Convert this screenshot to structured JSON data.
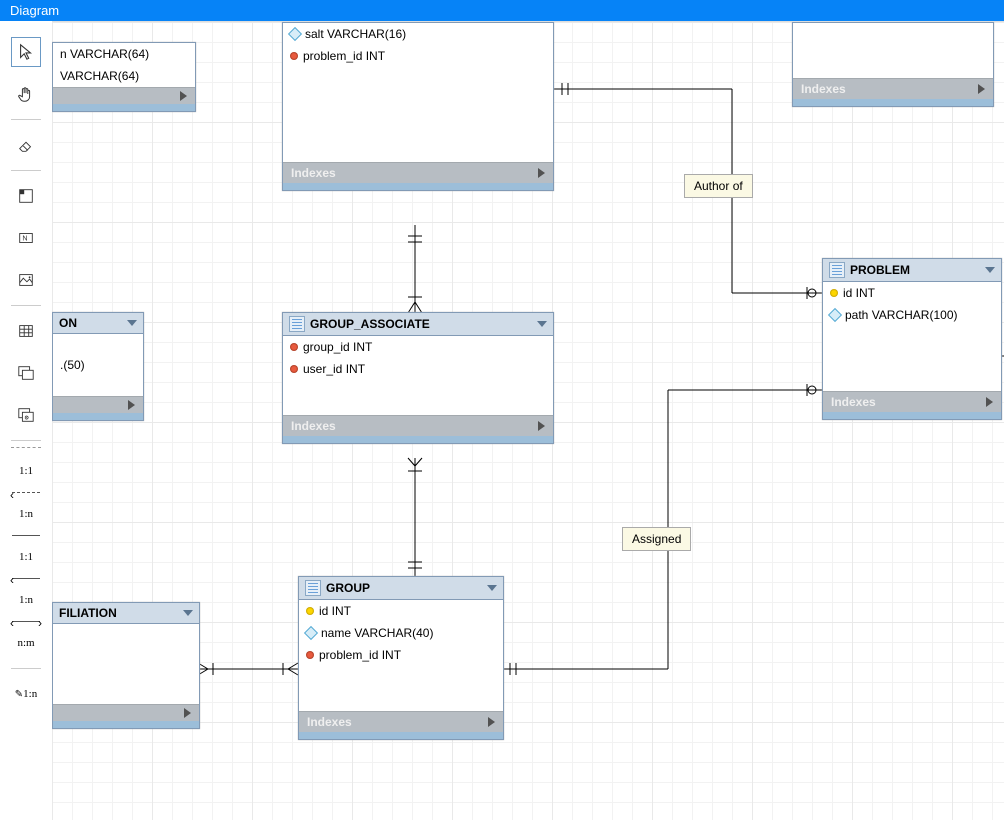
{
  "header": {
    "title": "Diagram"
  },
  "toolbar": {
    "tools": [
      {
        "name": "pointer-tool",
        "selected": true
      },
      {
        "name": "hand-tool"
      },
      {
        "name": "eraser-tool"
      },
      {
        "name": "layer-tool"
      },
      {
        "name": "note-tool"
      },
      {
        "name": "image-tool"
      },
      {
        "name": "table-tool"
      },
      {
        "name": "view-tool"
      },
      {
        "name": "routine-tool"
      }
    ],
    "rel": [
      {
        "name": "rel-1-1-dash",
        "label": "1:1"
      },
      {
        "name": "rel-1-n-dash",
        "label": "1:n"
      },
      {
        "name": "rel-1-1",
        "label": "1:1"
      },
      {
        "name": "rel-1-n",
        "label": "1:n"
      },
      {
        "name": "rel-n-m",
        "label": "n:m"
      },
      {
        "name": "rel-edit-1-n",
        "label": "1:n"
      }
    ]
  },
  "labels": {
    "author": "Author of",
    "assigned": "Assigned",
    "indexes": "Indexes"
  },
  "tables": {
    "problem": {
      "title": "PROBLEM",
      "cols": [
        {
          "icon": "key-y",
          "text": "id INT"
        },
        {
          "icon": "dia",
          "text": "path VARCHAR(100)"
        }
      ]
    },
    "group_associate": {
      "title": "GROUP_ASSOCIATE",
      "cols": [
        {
          "icon": "key-r",
          "text": "group_id INT"
        },
        {
          "icon": "key-r",
          "text": "user_id INT"
        }
      ]
    },
    "group": {
      "title": "GROUP",
      "cols": [
        {
          "icon": "key-y",
          "text": "id INT"
        },
        {
          "icon": "dia",
          "text": "name VARCHAR(40)"
        },
        {
          "icon": "key-r",
          "text": "problem_id INT"
        }
      ]
    },
    "user_partial": {
      "cols": [
        {
          "icon": "dia",
          "text": "salt VARCHAR(16)"
        },
        {
          "icon": "key-r",
          "text": "problem_id INT"
        }
      ]
    },
    "top_left_partial": {
      "cols": [
        {
          "text": "n VARCHAR(64)"
        },
        {
          "text": "VARCHAR(64)"
        }
      ]
    },
    "on_partial": {
      "title": "ON",
      "cols": [
        {
          "text": ".(50)"
        }
      ]
    },
    "filiation_partial": {
      "title": "FILIATION"
    },
    "top_right_partial": {}
  }
}
